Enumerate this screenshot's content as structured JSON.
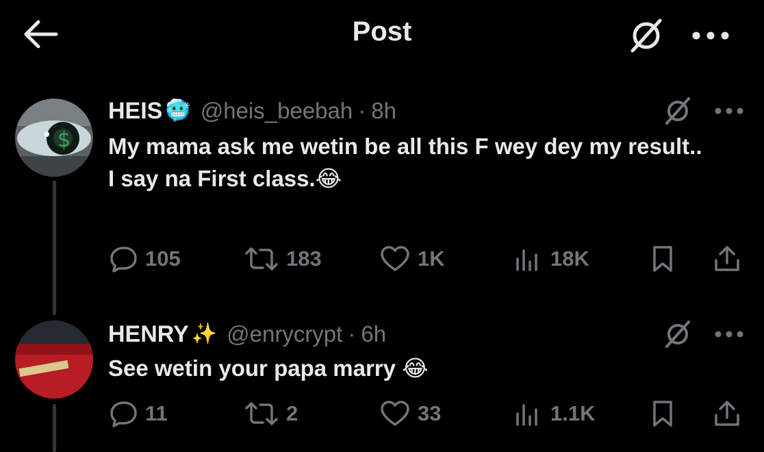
{
  "header": {
    "title": "Post",
    "back_icon": "arrow-left-icon",
    "grok_icon": "grok-icon",
    "more_icon": "more-horizontal-icon"
  },
  "posts": [
    {
      "name": "HEIS",
      "name_emoji": "🥶",
      "handle": "@heis_beebah",
      "separator": "·",
      "time": "8h",
      "text_lines": [
        "My mama ask me wetin be all this F wey dey my result..",
        "I say na First class.😂"
      ],
      "replies": "105",
      "reposts": "183",
      "likes": "1K",
      "views": "18K"
    },
    {
      "name": "HENRY",
      "name_emoji": "✨",
      "handle": "@enrycrypt",
      "separator": "·",
      "time": "6h",
      "text_lines": [
        "See wetin your papa marry 😂"
      ],
      "replies": "11",
      "reposts": "2",
      "likes": "33",
      "views": "1.1K"
    }
  ],
  "colors": {
    "background": "#000000",
    "primary_text": "#e7e9ea",
    "secondary_text": "#71767b",
    "thread_line": "#333639"
  }
}
